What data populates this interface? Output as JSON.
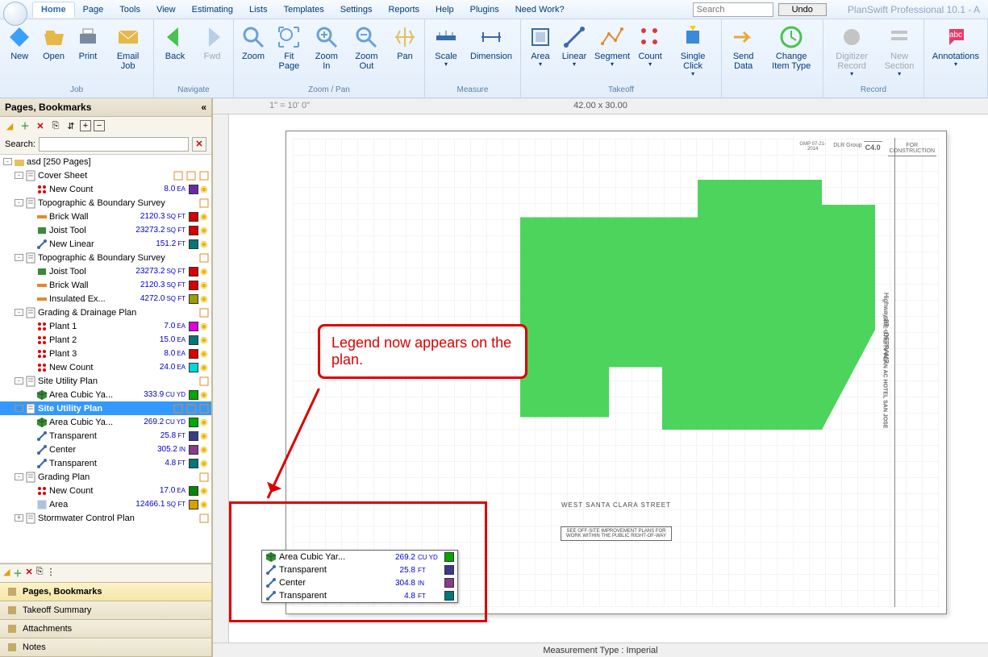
{
  "app_title": "PlanSwift Professional 10.1 - A",
  "menu": [
    "Home",
    "Page",
    "Tools",
    "View",
    "Estimating",
    "Lists",
    "Templates",
    "Settings",
    "Reports",
    "Help",
    "Plugins",
    "Need Work?"
  ],
  "active_menu": 0,
  "search_placeholder": "Search",
  "undo_label": "Undo",
  "ribbon": [
    {
      "name": "Job",
      "buttons": [
        {
          "label": "New",
          "icon": "new-icon",
          "color": "#3aa0ff"
        },
        {
          "label": "Open",
          "icon": "open-icon",
          "color": "#e6b84a"
        },
        {
          "label": "Print",
          "icon": "print-icon",
          "color": "#7a8aa0"
        },
        {
          "label": "Email\nJob",
          "icon": "email-icon",
          "color": "#e6b84a"
        }
      ]
    },
    {
      "name": "Navigate",
      "buttons": [
        {
          "label": "Back",
          "icon": "back-icon",
          "color": "#49c24f"
        },
        {
          "label": "Fwd",
          "icon": "fwd-icon",
          "color": "#b8cfe8",
          "disabled": true
        }
      ]
    },
    {
      "name": "Zoom / Pan",
      "buttons": [
        {
          "label": "Zoom",
          "icon": "zoom-icon",
          "color": "#6aa0d8"
        },
        {
          "label": "Fit\nPage",
          "icon": "fit-icon",
          "color": "#6aa0d8"
        },
        {
          "label": "Zoom\nIn",
          "icon": "zoomin-icon",
          "color": "#6aa0d8"
        },
        {
          "label": "Zoom\nOut",
          "icon": "zoomout-icon",
          "color": "#6aa0d8"
        },
        {
          "label": "Pan",
          "icon": "pan-icon",
          "color": "#e0c060"
        }
      ]
    },
    {
      "name": "Measure",
      "buttons": [
        {
          "label": "Scale",
          "icon": "scale-icon",
          "color": "#3a6aa8",
          "drop": true
        },
        {
          "label": "Dimension",
          "icon": "dim-icon",
          "color": "#3a6aa8"
        }
      ]
    },
    {
      "name": "Takeoff",
      "buttons": [
        {
          "label": "Area",
          "icon": "area-icon",
          "color": "#3a6aa8",
          "drop": true
        },
        {
          "label": "Linear",
          "icon": "linear-icon",
          "color": "#3a6aa8",
          "drop": true
        },
        {
          "label": "Segment",
          "icon": "segment-icon",
          "color": "#e38a2a",
          "drop": true
        },
        {
          "label": "Count",
          "icon": "count-icon",
          "color": "#d83a3a",
          "drop": true
        },
        {
          "label": "Single\nClick",
          "icon": "single-icon",
          "color": "#3a8ad8",
          "drop": true
        }
      ]
    },
    {
      "name": "",
      "buttons": [
        {
          "label": "Send\nData",
          "icon": "send-icon",
          "color": "#e8a838"
        },
        {
          "label": "Change\nItem Type",
          "icon": "change-icon",
          "color": "#49c24f"
        }
      ]
    },
    {
      "name": "Record",
      "buttons": [
        {
          "label": "Digitizer\nRecord",
          "icon": "digi-icon",
          "color": "#c4c4c4",
          "disabled": true,
          "drop": true
        },
        {
          "label": "New\nSection",
          "icon": "sect-icon",
          "color": "#c4c4c4",
          "disabled": true,
          "drop": true
        }
      ]
    },
    {
      "name": "",
      "buttons": [
        {
          "label": "Annotations",
          "icon": "ann-icon",
          "color": "#e83a6a",
          "drop": true
        }
      ]
    }
  ],
  "panel": {
    "title": "Pages, Bookmarks",
    "collapse": "«",
    "search_label": "Search:",
    "tree": [
      {
        "d": 0,
        "exp": "-",
        "icon": "folder",
        "name": "asd [250 Pages]"
      },
      {
        "d": 1,
        "exp": "-",
        "icon": "page",
        "name": "Cover Sheet",
        "tail": [
          "t1",
          "t2",
          "t3"
        ]
      },
      {
        "d": 2,
        "icon": "count",
        "name": "New Count",
        "val": "8.0",
        "unit": "EA",
        "color": "#6a2aa8"
      },
      {
        "d": 1,
        "exp": "-",
        "icon": "page",
        "name": "Topographic & Boundary Survey",
        "tail": [
          "t3"
        ]
      },
      {
        "d": 2,
        "icon": "lin",
        "name": "Brick Wall",
        "val": "2120.3",
        "unit": "SQ FT",
        "color": "#d80000"
      },
      {
        "d": 2,
        "icon": "joist",
        "name": "Joist Tool",
        "val": "23273.2",
        "unit": "SQ FT",
        "color": "#d80000"
      },
      {
        "d": 2,
        "icon": "lin2",
        "name": "New Linear",
        "val": "151.2",
        "unit": "FT",
        "color": "#00787a"
      },
      {
        "d": 1,
        "exp": "-",
        "icon": "page",
        "name": "Topographic & Boundary Survey",
        "tail": [
          "t3"
        ]
      },
      {
        "d": 2,
        "icon": "joist",
        "name": "Joist Tool",
        "val": "23273.2",
        "unit": "SQ FT",
        "color": "#d80000"
      },
      {
        "d": 2,
        "icon": "lin",
        "name": "Brick Wall",
        "val": "2120.3",
        "unit": "SQ FT",
        "color": "#d80000"
      },
      {
        "d": 2,
        "icon": "lin",
        "name": "Insulated Ex...",
        "val": "4272.0",
        "unit": "SQ FT",
        "color": "#9aa000"
      },
      {
        "d": 1,
        "exp": "-",
        "icon": "page",
        "name": "Grading & Drainage Plan",
        "tail": [
          "t3"
        ]
      },
      {
        "d": 2,
        "icon": "count",
        "name": "Plant 1",
        "val": "7.0",
        "unit": "EA",
        "color": "#e000e0"
      },
      {
        "d": 2,
        "icon": "count",
        "name": "Plant 2",
        "val": "15.0",
        "unit": "EA",
        "color": "#00787a"
      },
      {
        "d": 2,
        "icon": "count",
        "name": "Plant 3",
        "val": "8.0",
        "unit": "EA",
        "color": "#d80000"
      },
      {
        "d": 2,
        "icon": "count",
        "name": "New Count",
        "val": "24.0",
        "unit": "EA",
        "color": "#00d8d8"
      },
      {
        "d": 1,
        "exp": "-",
        "icon": "page",
        "name": "Site Utility Plan",
        "tail": [
          "t3"
        ]
      },
      {
        "d": 2,
        "icon": "cube",
        "name": "Area Cubic Ya...",
        "val": "333.9",
        "unit": "CU YD",
        "color": "#00a800"
      },
      {
        "d": 1,
        "exp": "-",
        "icon": "page",
        "name": "Site Utility Plan",
        "sel": true,
        "tail": [
          "t1",
          "t2",
          "t3"
        ]
      },
      {
        "d": 2,
        "icon": "cube",
        "name": "Area Cubic Ya...",
        "val": "269.2",
        "unit": "CU YD",
        "color": "#00a800"
      },
      {
        "d": 2,
        "icon": "lin2",
        "name": "Transparent",
        "val": "25.8",
        "unit": "FT",
        "color": "#3a3a8a"
      },
      {
        "d": 2,
        "icon": "lin2",
        "name": "Center",
        "val": "305.2",
        "unit": "IN",
        "color": "#8a3a8a"
      },
      {
        "d": 2,
        "icon": "lin2",
        "name": "Transparent",
        "val": "4.8",
        "unit": "FT",
        "color": "#00787a"
      },
      {
        "d": 1,
        "exp": "-",
        "icon": "page",
        "name": "Grading Plan",
        "tail": [
          "t3"
        ]
      },
      {
        "d": 2,
        "icon": "count",
        "name": "New Count",
        "val": "17.0",
        "unit": "EA",
        "color": "#008a00"
      },
      {
        "d": 2,
        "icon": "area",
        "name": "Area",
        "val": "12466.1",
        "unit": "SQ FT",
        "color": "#d8a000"
      },
      {
        "d": 1,
        "exp": "+",
        "icon": "page",
        "name": "Stormwater Control Plan",
        "tail": [
          "t3"
        ]
      }
    ],
    "tabs": [
      {
        "label": "Pages, Bookmarks",
        "active": true,
        "icon": "book"
      },
      {
        "label": "Takeoff Summary",
        "icon": "sum"
      },
      {
        "label": "Attachments",
        "icon": "att"
      },
      {
        "label": "Notes",
        "icon": "note"
      }
    ]
  },
  "canvas": {
    "scale": "1\" = 10' 0\"",
    "dims": "42.00 x 30.00",
    "status": "Measurement Type : Imperial",
    "street": "WEST SANTA CLARA STREET",
    "hwy": "Highway 87 - OFFRAMP",
    "note": "SEE OFF-SITE IMPROVEMENT PLANS FOR\nWORK WITHIN THE PUBLIC RIGHT-OF-WAY",
    "title_block": "SITE UTILITY PLAN\nAC HOTEL SAN JOSE",
    "sheet": "C4.0",
    "stamp": "FOR CONSTRUCTION",
    "firm": "DLR Group",
    "date": "GMP 07-21-2014"
  },
  "callout": "Legend now appears on the plan.",
  "legend": [
    {
      "icon": "cube",
      "name": "Area Cubic Yar...",
      "val": "269.2",
      "unit": "CU YD",
      "color": "#00a800"
    },
    {
      "icon": "lin2",
      "name": "Transparent",
      "val": "25.8",
      "unit": "FT",
      "color": "#3a3a8a"
    },
    {
      "icon": "lin2",
      "name": "Center",
      "val": "304.8",
      "unit": "IN",
      "color": "#8a3a8a"
    },
    {
      "icon": "lin2",
      "name": "Transparent",
      "val": "4.8",
      "unit": "FT",
      "color": "#00787a"
    }
  ]
}
